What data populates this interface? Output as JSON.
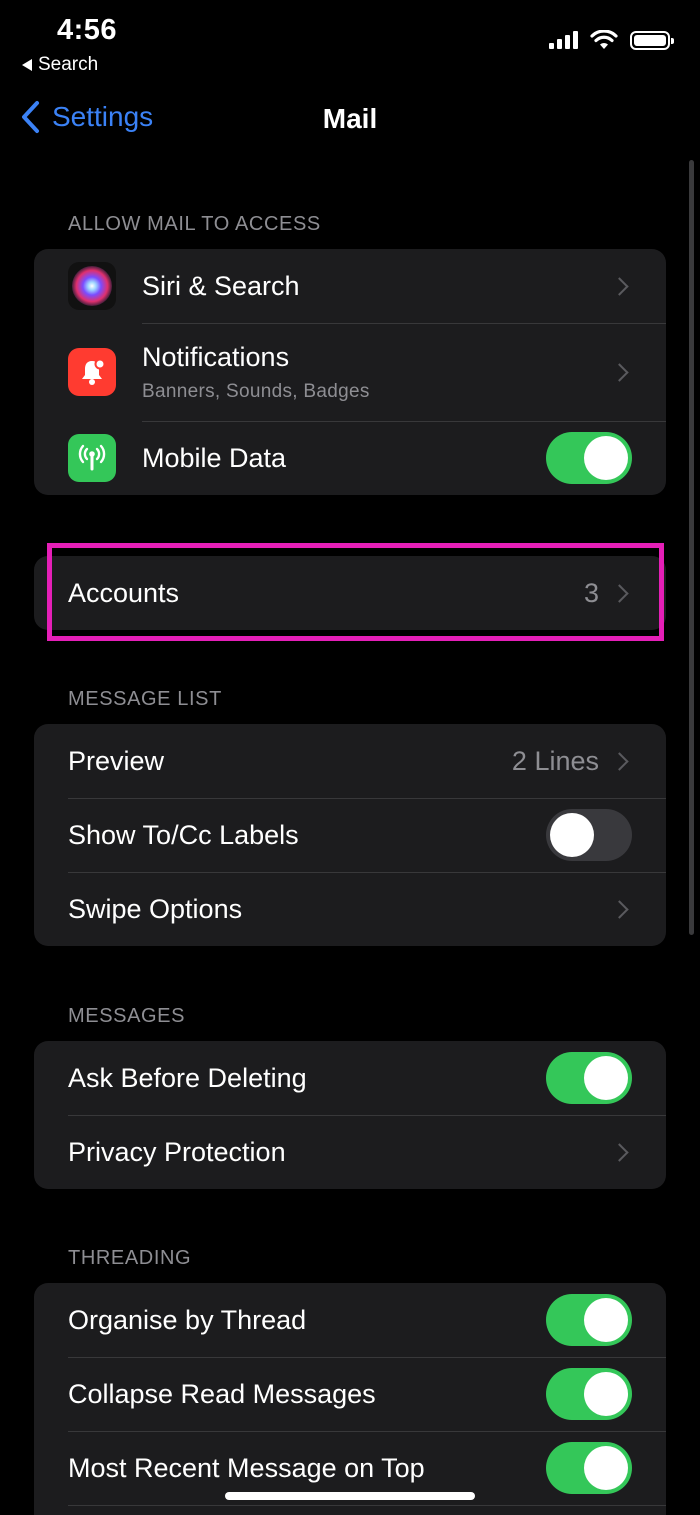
{
  "status_bar": {
    "time": "4:56",
    "back_app": "Search"
  },
  "nav": {
    "back_label": "Settings",
    "title": "Mail"
  },
  "sections": {
    "allow_access": {
      "header": "ALLOW MAIL TO ACCESS",
      "siri": {
        "label": "Siri & Search",
        "icon": "siri-icon"
      },
      "notifications": {
        "label": "Notifications",
        "sublabel": "Banners, Sounds, Badges",
        "icon": "notification-bell-icon",
        "color": "#ff3b30"
      },
      "mobile_data": {
        "label": "Mobile Data",
        "icon": "antenna-icon",
        "color": "#34c759",
        "enabled": true
      }
    },
    "accounts": {
      "label": "Accounts",
      "value": "3"
    },
    "message_list": {
      "header": "MESSAGE LIST",
      "preview": {
        "label": "Preview",
        "value": "2 Lines"
      },
      "show_to_cc": {
        "label": "Show To/Cc Labels",
        "enabled": false
      },
      "swipe_options": {
        "label": "Swipe Options"
      }
    },
    "messages": {
      "header": "MESSAGES",
      "ask_before_deleting": {
        "label": "Ask Before Deleting",
        "enabled": true
      },
      "privacy_protection": {
        "label": "Privacy Protection"
      }
    },
    "threading": {
      "header": "THREADING",
      "organise_by_thread": {
        "label": "Organise by Thread",
        "enabled": true
      },
      "collapse_read": {
        "label": "Collapse Read Messages",
        "enabled": true
      },
      "most_recent_on_top": {
        "label": "Most Recent Message on Top",
        "enabled": true
      }
    }
  },
  "colors": {
    "accent": "#3b82f6",
    "toggle_on": "#34c759",
    "highlight": "#e51fb7"
  }
}
